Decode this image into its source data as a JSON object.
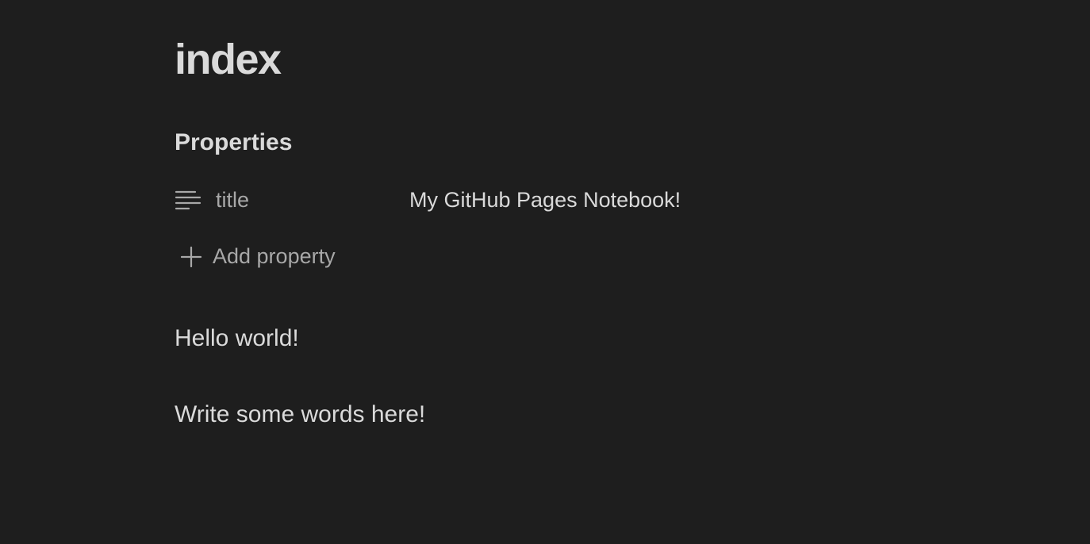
{
  "note": {
    "title": "index",
    "properties": {
      "heading": "Properties",
      "items": [
        {
          "icon": "text-lines-icon",
          "key": "title",
          "value": "My GitHub Pages Notebook!"
        }
      ],
      "add_label": "Add property",
      "add_icon": "plus-icon"
    },
    "body": {
      "paragraphs": [
        "Hello world!",
        "Write some words here!"
      ]
    }
  },
  "colors": {
    "background": "#1e1e1e",
    "text": "#dadada",
    "muted_text": "#a8a8a8"
  }
}
